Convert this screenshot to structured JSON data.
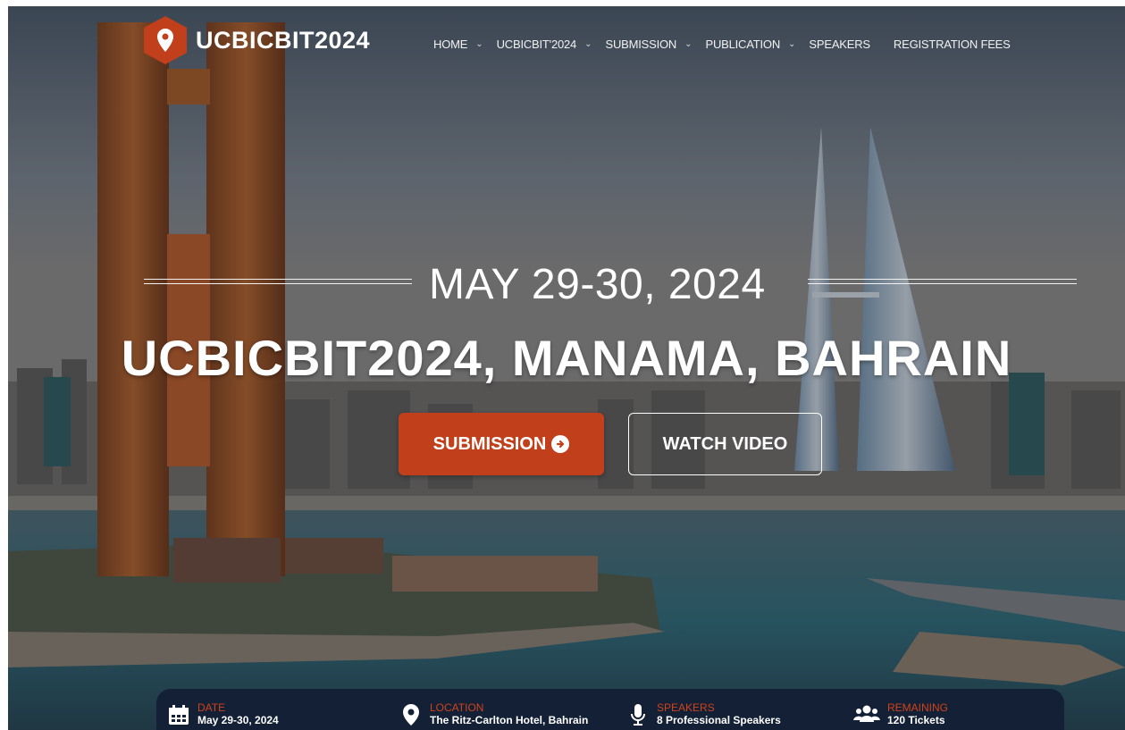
{
  "brand": {
    "name": "UCBICBIT2024",
    "badge_color": "#c1401b"
  },
  "nav": {
    "items": [
      {
        "label": "HOME",
        "has_dropdown": true
      },
      {
        "label": "UCBICBIT'2024",
        "has_dropdown": true
      },
      {
        "label": "SUBMISSION",
        "has_dropdown": true
      },
      {
        "label": "PUBLICATION",
        "has_dropdown": true
      },
      {
        "label": "SPEAKERS",
        "has_dropdown": false
      },
      {
        "label": "REGISTRATION FEES",
        "has_dropdown": false
      }
    ],
    "caret": "⌄"
  },
  "hero": {
    "date": "MAY 29-30, 2024",
    "title": "UCBICBIT2024, MANAMA, BAHRAIN",
    "submit_label": "SUBMISSION",
    "submit_icon": "arrow-circle-right-icon",
    "watch_label": "WATCH VIDEO"
  },
  "info": {
    "items": [
      {
        "icon": "calendar-icon",
        "label": "DATE",
        "value": "May 29-30, 2024"
      },
      {
        "icon": "map-pin-icon",
        "label": "LOCATION",
        "value": "The Ritz-Carlton Hotel, Bahrain"
      },
      {
        "icon": "microphone-icon",
        "label": "SPEAKERS",
        "value": "8 Professional Speakers"
      },
      {
        "icon": "users-icon",
        "label": "REMAINING",
        "value": "120 Tickets"
      }
    ]
  },
  "colors": {
    "accent": "#c1401b",
    "info_bar": "#132036",
    "label": "#d0431a"
  }
}
